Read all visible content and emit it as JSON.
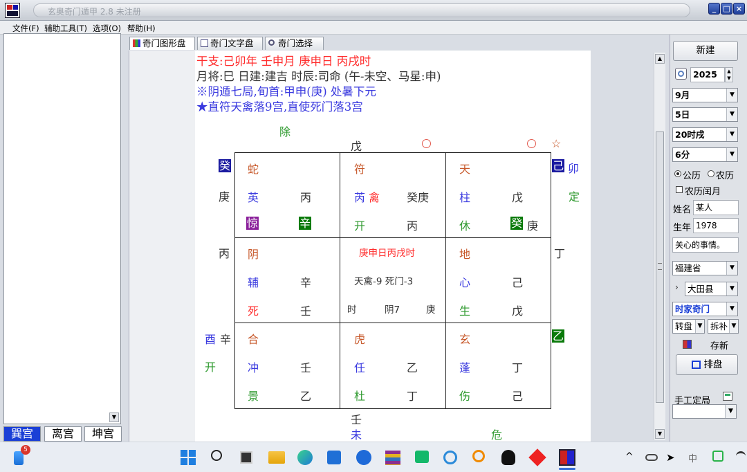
{
  "window": {
    "title": "玄奥奇门遁甲 2.8 未注册"
  },
  "menu": [
    "文件(F)",
    "辅助工具(T)",
    "选项(O)",
    "帮助(H)"
  ],
  "left_tabs": [
    "巽宫",
    "离宫",
    "坤宫"
  ],
  "tabs": [
    "奇门图形盘",
    "奇门文字盘",
    "奇门选择"
  ],
  "header": {
    "line1": "干支:己卯年 壬申月 庚申日 丙戌时",
    "line2": "月将:巳 日建:建吉 时辰:司命 (午-未空、马星:申)",
    "line3": "※阴遁七局,旬首:甲申(庚)  处暑下元",
    "line4": "★直符天禽落9宫,直使死门落3宫"
  },
  "chart": {
    "outer": {
      "chu": "除",
      "top_wu": "戊",
      "nw_gui": "癸",
      "ne_ji": "己",
      "ne_mao": "卯",
      "w_geng": "庚",
      "e_ding_label": "定",
      "w_bing": "丙",
      "e_ding": "丁",
      "sw_you": "酉",
      "sw_xin": "辛",
      "sw_kai": "开",
      "se_yi": "乙",
      "bottom_ren": "壬",
      "bottom_wei": "未",
      "bottom_wei2": "危",
      "star": "☆"
    },
    "palaces": {
      "nw": {
        "god": "蛇",
        "star": "英",
        "star_gan": "丙",
        "door": "惊",
        "door_gan": "辛"
      },
      "n": {
        "god": "符",
        "star": "芮",
        "star2": "禽",
        "star_gan": "癸庚",
        "door": "开",
        "door_gan": "丙"
      },
      "ne": {
        "god": "天",
        "star": "柱",
        "star_gan": "戊",
        "door": "休",
        "door_gan": "癸",
        "door_gan2": "庚"
      },
      "w": {
        "god": "阴",
        "star": "辅",
        "star_gan": "辛",
        "door": "死",
        "door_gan": "壬"
      },
      "c": {
        "line1": "庚申日丙戌时",
        "line2": "天禽-9 死门-3",
        "shi": "时",
        "yin": "阴7",
        "geng": "庚"
      },
      "e": {
        "god": "地",
        "star": "心",
        "star_gan": "己",
        "door": "生",
        "door_gan": "戊"
      },
      "sw": {
        "god": "合",
        "star": "冲",
        "star_gan": "壬",
        "door": "景",
        "door_gan": "乙"
      },
      "s": {
        "god": "虎",
        "star": "任",
        "star_gan": "乙",
        "door": "杜",
        "door_gan": "丁"
      },
      "se": {
        "god": "玄",
        "star": "蓬",
        "star_gan": "丁",
        "door": "伤",
        "door_gan": "己"
      }
    }
  },
  "right": {
    "new_button": "新建",
    "year": "2025",
    "month": "9月",
    "day": "5日",
    "hour": "20时戌",
    "minute": "6分",
    "solar": "公历",
    "lunar": "农历",
    "leap": "农历闰月",
    "name_label": "姓名",
    "name_value": "某人",
    "birth_label": "生年",
    "birth_value": "1978",
    "concern": "关心的事情。",
    "province": "福建省",
    "county": "大田县",
    "method": "时家奇门",
    "rotate": "转盘",
    "split": "拆补",
    "save_new": "存新",
    "arrange": "排盘",
    "manual": "手工定局"
  },
  "taskbar": {
    "badge": "5"
  }
}
